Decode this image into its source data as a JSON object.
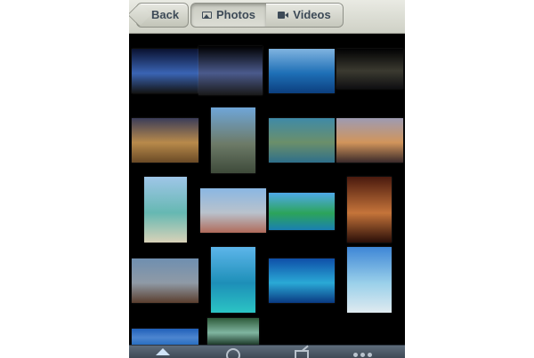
{
  "navbar": {
    "back_label": "Back",
    "segments": [
      {
        "label": "Photos",
        "icon": "photo-icon",
        "selected": true
      },
      {
        "label": "Videos",
        "icon": "video-camera-icon",
        "selected": false
      }
    ]
  },
  "gallery": {
    "thumbnails": [
      {
        "name": "thumb-stadium-night",
        "colors": [
          "#0a1230",
          "#3a64b4",
          "#141414"
        ]
      },
      {
        "name": "thumb-fireworks",
        "colors": [
          "#000000",
          "#4b5a8c",
          "#1a1a1a"
        ]
      },
      {
        "name": "thumb-ocean-wave",
        "colors": [
          "#7fb3e0",
          "#1e6fb6",
          "#0c3f7e"
        ]
      },
      {
        "name": "thumb-cruise-ship-night",
        "colors": [
          "#020203",
          "#3b3a30",
          "#0f0f12"
        ]
      },
      {
        "name": "thumb-street-evening",
        "colors": [
          "#3b3d59",
          "#b88a4b",
          "#6a4a26"
        ]
      },
      {
        "name": "thumb-fortress-coast",
        "colors": [
          "#6fa6d8",
          "#6d7b68",
          "#3e4a3a"
        ]
      },
      {
        "name": "thumb-fort-aerial",
        "colors": [
          "#3f8aa7",
          "#6b8f6a",
          "#2e6f8a"
        ]
      },
      {
        "name": "thumb-harbor-sunset",
        "colors": [
          "#9e9bb2",
          "#d1955b",
          "#3a2a2a"
        ]
      },
      {
        "name": "thumb-beach-shore",
        "colors": [
          "#9fc6e8",
          "#66b8b2",
          "#d9d2b8"
        ]
      },
      {
        "name": "thumb-city-bay",
        "colors": [
          "#8ab7e3",
          "#b9c2cc",
          "#b06a5a"
        ]
      },
      {
        "name": "thumb-palm-island",
        "colors": [
          "#4fa9e8",
          "#2ca45a",
          "#1a7fb2"
        ]
      },
      {
        "name": "thumb-restaurant-night",
        "colors": [
          "#4a1a0e",
          "#c5743a",
          "#2a0e08"
        ]
      },
      {
        "name": "thumb-coastal-rainbow",
        "colors": [
          "#6f8fb0",
          "#8f9aa6",
          "#5a3e2e"
        ]
      },
      {
        "name": "thumb-sailboat-water",
        "colors": [
          "#5db5ea",
          "#1d8fb8",
          "#2bc4c4"
        ]
      },
      {
        "name": "thumb-atoll-aerial",
        "colors": [
          "#0e4fa8",
          "#2aa9d6",
          "#0a3a82"
        ]
      },
      {
        "name": "thumb-palm-lagoon",
        "colors": [
          "#3e86d6",
          "#9ad0ea",
          "#dfeaf0"
        ]
      },
      {
        "name": "thumb-blue-sky-palm",
        "colors": [
          "#1f5fb9",
          "#4d86d0",
          "#2a6ec0"
        ]
      },
      {
        "name": "thumb-waterfall",
        "colors": [
          "#2e5a3a",
          "#7fb5a0",
          "#1e3a2a"
        ]
      }
    ]
  },
  "toolbar": {
    "items": [
      {
        "icon": "home-icon",
        "selected": true
      },
      {
        "icon": "clock-icon",
        "selected": false
      },
      {
        "icon": "share-icon",
        "selected": false
      },
      {
        "icon": "more-icon",
        "selected": false
      }
    ]
  }
}
